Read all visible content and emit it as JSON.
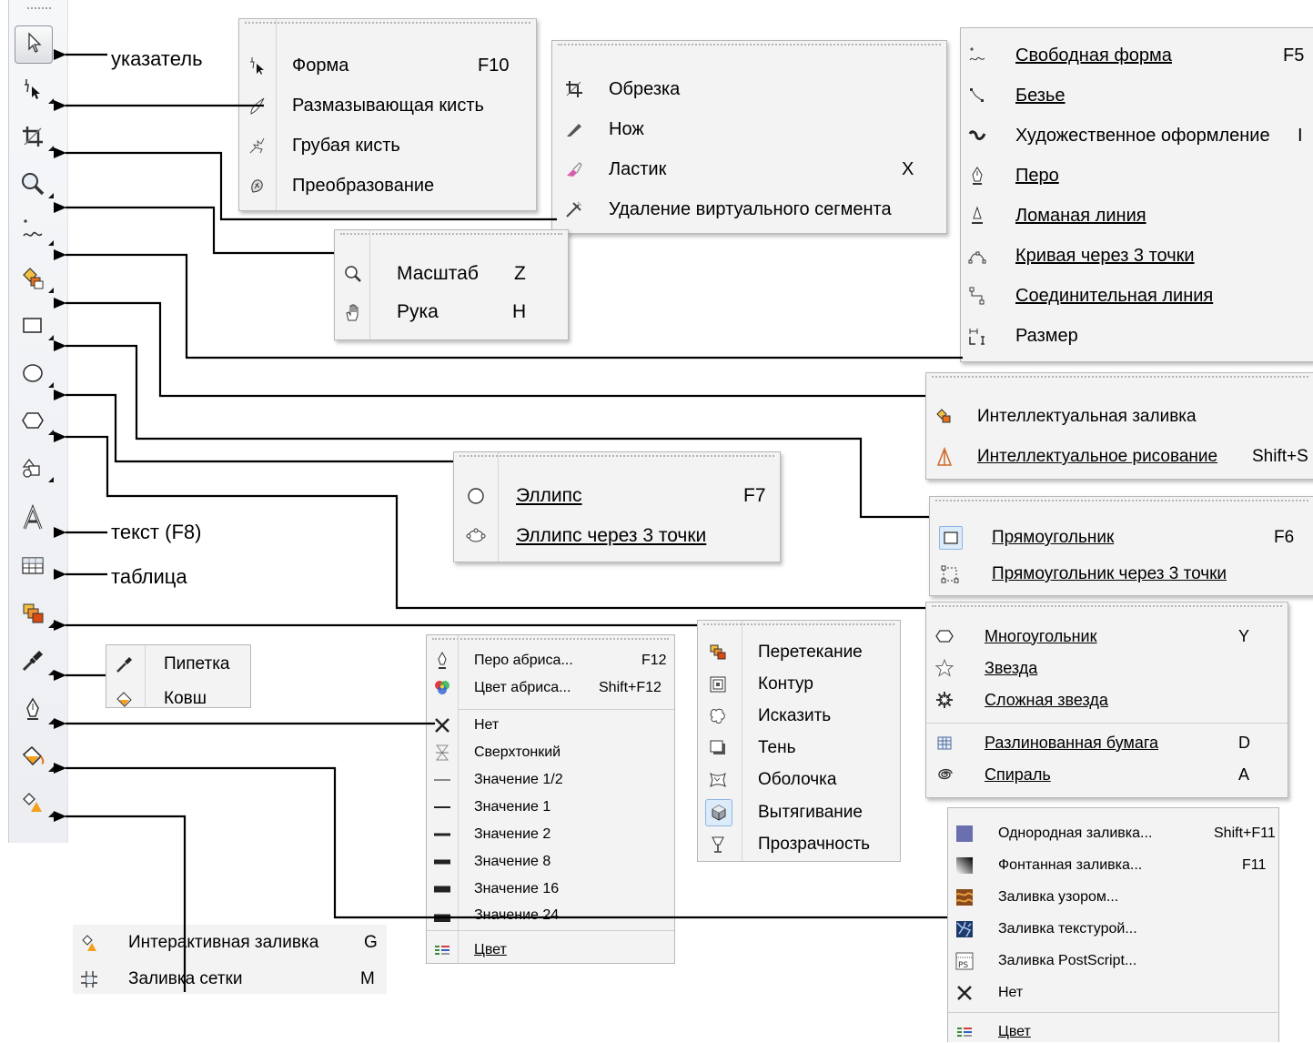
{
  "annotations": {
    "pointer": "указатель",
    "text": "текст (F8)",
    "table": "таблица"
  },
  "toolbar_icons": [
    "pick-icon",
    "shape-icon",
    "crop-icon",
    "zoom-icon",
    "freehand-icon",
    "smart-fill-icon",
    "rectangle-icon",
    "ellipse-icon",
    "polygon-icon",
    "basic-shapes-icon",
    "text-icon",
    "table-icon",
    "blend-icon",
    "eyedropper-icon",
    "outline-pen-icon",
    "fill-bucket-icon",
    "interactive-fill-icon"
  ],
  "menus": {
    "shape": {
      "items": [
        {
          "label": "Форма",
          "key": "F10"
        },
        {
          "label": "Размазывающая кисть",
          "key": ""
        },
        {
          "label": "Грубая кисть",
          "key": ""
        },
        {
          "label": "Преобразование",
          "key": ""
        }
      ]
    },
    "crop": {
      "items": [
        {
          "label": "Обрезка",
          "key": ""
        },
        {
          "label": "Нож",
          "key": ""
        },
        {
          "label": "Ластик",
          "key": "X"
        },
        {
          "label": "Удаление виртуального сегмента",
          "key": ""
        }
      ]
    },
    "curve": {
      "items": [
        {
          "label": "Свободная форма",
          "key": "F5"
        },
        {
          "label": "Безье",
          "key": ""
        },
        {
          "label": "Художественное оформление",
          "key": "I"
        },
        {
          "label": "Перо",
          "key": ""
        },
        {
          "label": "Ломаная линия",
          "key": ""
        },
        {
          "label": "Кривая через 3 точки",
          "key": ""
        },
        {
          "label": "Соединительная линия",
          "key": ""
        },
        {
          "label": "Размер",
          "key": ""
        }
      ]
    },
    "zoom": {
      "items": [
        {
          "label": "Масштаб",
          "key": "Z"
        },
        {
          "label": "Рука",
          "key": "H"
        }
      ]
    },
    "smart": {
      "items": [
        {
          "label": "Интеллектуальная заливка",
          "key": ""
        },
        {
          "label": "Интеллектуальное рисование",
          "key": "Shift+S"
        }
      ]
    },
    "ellipse": {
      "items": [
        {
          "label": "Эллипс",
          "key": "F7"
        },
        {
          "label": "Эллипс через 3 точки",
          "key": ""
        }
      ]
    },
    "rect": {
      "items": [
        {
          "label": "Прямоугольник",
          "key": "F6"
        },
        {
          "label": "Прямоугольник через 3 точки",
          "key": ""
        }
      ]
    },
    "polygon": {
      "items": [
        {
          "label": "Многоугольник",
          "key": "Y"
        },
        {
          "label": "Звезда",
          "key": ""
        },
        {
          "label": "Сложная звезда",
          "key": ""
        },
        {
          "label": "Разлинованная бумага",
          "key": "D"
        },
        {
          "label": "Спираль",
          "key": "A"
        }
      ]
    },
    "eyedrop": {
      "items": [
        {
          "label": "Пипетка",
          "key": ""
        },
        {
          "label": "Ковш",
          "key": ""
        }
      ]
    },
    "outline": {
      "items": [
        {
          "label": "Перо абриса...",
          "key": "F12"
        },
        {
          "label": "Цвет абриса...",
          "key": "Shift+F12"
        },
        {
          "label": "Нет",
          "key": ""
        },
        {
          "label": "Сверхтонкий",
          "key": ""
        },
        {
          "label": "Значение 1/2",
          "key": ""
        },
        {
          "label": "Значение 1",
          "key": ""
        },
        {
          "label": "Значение 2",
          "key": ""
        },
        {
          "label": "Значение 8",
          "key": ""
        },
        {
          "label": "Значение 16",
          "key": ""
        },
        {
          "label": "Значение 24",
          "key": ""
        },
        {
          "label": "Цвет",
          "key": ""
        }
      ]
    },
    "effects": {
      "items": [
        {
          "label": "Перетекание",
          "key": ""
        },
        {
          "label": "Контур",
          "key": ""
        },
        {
          "label": "Исказить",
          "key": ""
        },
        {
          "label": "Тень",
          "key": ""
        },
        {
          "label": "Оболочка",
          "key": ""
        },
        {
          "label": "Вытягивание",
          "key": ""
        },
        {
          "label": "Прозрачность",
          "key": ""
        }
      ]
    },
    "fill": {
      "items": [
        {
          "label": "Однородная заливка...",
          "key": "Shift+F11"
        },
        {
          "label": "Фонтанная заливка...",
          "key": "F11"
        },
        {
          "label": "Заливка узором...",
          "key": ""
        },
        {
          "label": "Заливка текстурой...",
          "key": ""
        },
        {
          "label": "Заливка PostScript...",
          "key": ""
        },
        {
          "label": "Нет",
          "key": ""
        },
        {
          "label": "Цвет",
          "key": ""
        }
      ]
    },
    "interactive": {
      "items": [
        {
          "label": "Интерактивная заливка",
          "key": "G"
        },
        {
          "label": "Заливка сетки",
          "key": "M"
        }
      ]
    }
  },
  "colors": {
    "arrow": "#000000",
    "menu_bg": "#f3f3f3",
    "uniform_fill": "#6a6fb0",
    "accent_orange": "#e8701a"
  }
}
